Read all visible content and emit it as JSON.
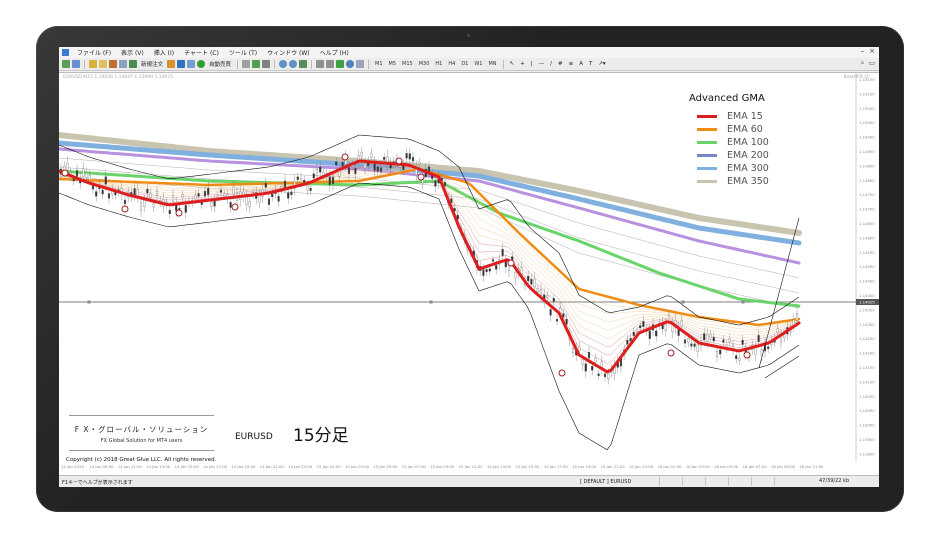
{
  "menu": [
    "ファイル (F)",
    "表示 (V)",
    "挿入 (I)",
    "チャート (C)",
    "ツール (T)",
    "ウィンドウ (W)",
    "ヘルプ (H)"
  ],
  "toolbar": {
    "new_order_label": "新規注文",
    "auto_trade_label": "自動売買",
    "timeframes": [
      "M1",
      "M5",
      "M15",
      "M30",
      "H1",
      "H4",
      "D1",
      "W1",
      "MN"
    ]
  },
  "chart": {
    "symbol_info": "EURUSD,M15 1.14026 1.14047 1.13990 1.14025",
    "trade_panel": "SmartFX ☺",
    "price_line_label": "1.14025",
    "pair": "EURUSD",
    "timeframe_label": "15分足",
    "price_axis": [
      "1.15150",
      "1.15100",
      "1.15050",
      "1.15000",
      "1.14950",
      "1.14900",
      "1.14850",
      "1.14800",
      "1.14750",
      "1.14700",
      "1.14650",
      "1.14600",
      "1.14550",
      "1.14500",
      "1.14450",
      "1.14400",
      "1.14350",
      "1.14300",
      "1.14250",
      "1.14200",
      "1.14150",
      "1.14100",
      "1.14050",
      "1.14000",
      "1.13950",
      "1.13900",
      "1.13850"
    ],
    "time_axis": [
      "14 Jan 2019",
      "14 Jan 09:00",
      "14 Jan 11:00",
      "14 Jan 13:00",
      "14 Jan 15:00",
      "14 Jan 17:00",
      "14 Jan 19:00",
      "14 Jan 21:00",
      "14 Jan 23:00",
      "15 Jan 01:00",
      "15 Jan 03:00",
      "15 Jan 05:00",
      "15 Jan 07:00",
      "15 Jan 09:00",
      "15 Jan 11:00",
      "15 Jan 13:00",
      "15 Jan 15:00",
      "15 Jan 17:00",
      "15 Jan 19:00",
      "15 Jan 21:00",
      "15 Jan 23:00",
      "16 Jan 01:00",
      "16 Jan 03:00",
      "16 Jan 05:00",
      "16 Jan 07:00",
      "16 Jan 09:00",
      "16 Jan 11:00"
    ]
  },
  "legend": {
    "title": "Advanced GMA",
    "items": [
      {
        "label": "EMA 15",
        "color": "#dc1e1e"
      },
      {
        "label": "EMA 60",
        "color": "#f08c14"
      },
      {
        "label": "EMA 100",
        "color": "#6ad46a"
      },
      {
        "label": "EMA 200",
        "color": "#7a86c8"
      },
      {
        "label": "EMA 300",
        "color": "#7fb0e0"
      },
      {
        "label": "EMA 350",
        "color": "#c8c4b0"
      }
    ]
  },
  "branding": {
    "name_jp": "F X・グローバル・ソリューション",
    "name_en": "FX Global Solution for MT4 users",
    "copyright": "Copyright (c) 2018   Great Glue LLC.  All rights reserved."
  },
  "status": {
    "help": "F1キーでヘルプが表示されます",
    "profile": "[ DEFAULT ]   EURUSD",
    "connection": "47/39/22 kb"
  }
}
